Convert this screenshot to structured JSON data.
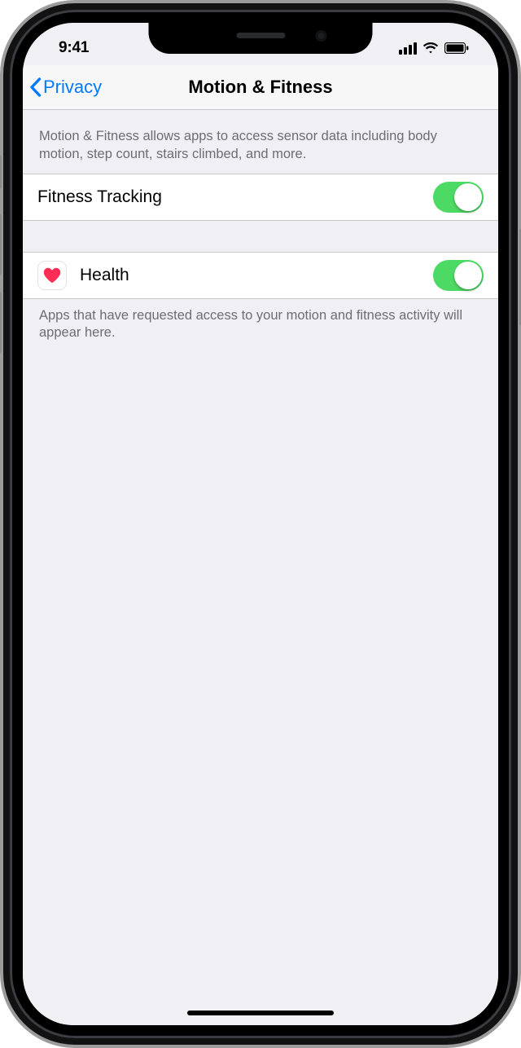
{
  "status": {
    "time": "9:41"
  },
  "nav": {
    "back_label": "Privacy",
    "title": "Motion & Fitness"
  },
  "section_header": "Motion & Fitness allows apps to access sensor data including body motion, step count, stairs climbed, and more.",
  "rows": {
    "fitness_tracking": {
      "label": "Fitness Tracking",
      "enabled": true
    },
    "health": {
      "label": "Health",
      "icon": "heart-icon",
      "enabled": true
    }
  },
  "section_footer": "Apps that have requested access to your motion and fitness activity will appear here.",
  "colors": {
    "accent": "#007aff",
    "toggle_on": "#4cd964",
    "bg": "#efeff4"
  }
}
